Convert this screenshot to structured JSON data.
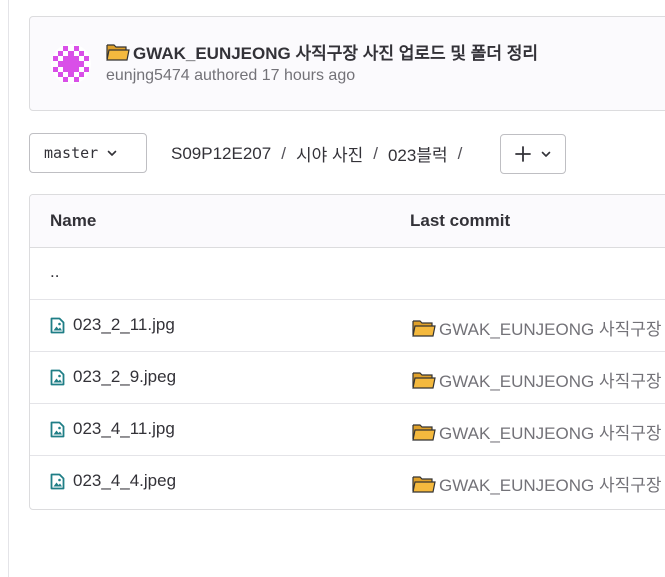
{
  "commit": {
    "emoji_icon": "open-folder-icon",
    "title": "GWAK_EUNJEONG 사직구장 사진 업로드 및 폴더 정리",
    "author": "eunjng5474",
    "authored_label": "authored",
    "time_ago": "17 hours ago"
  },
  "toolbar": {
    "branch": "master",
    "breadcrumb": [
      "S09P12E207",
      "시야 사진",
      "023블럭"
    ],
    "separator": "/",
    "add_icon": "plus-icon"
  },
  "table": {
    "headers": {
      "name": "Name",
      "last_commit": "Last commit"
    },
    "parent_dir": "..",
    "files": [
      {
        "name": "023_2_11.jpg",
        "commit": "GWAK_EUNJEONG 사직구장"
      },
      {
        "name": "023_2_9.jpeg",
        "commit": "GWAK_EUNJEONG 사직구장"
      },
      {
        "name": "023_4_11.jpg",
        "commit": "GWAK_EUNJEONG 사직구장"
      },
      {
        "name": "023_4_4.jpeg",
        "commit": "GWAK_EUNJEONG 사직구장"
      }
    ]
  },
  "colors": {
    "file_icon": "#1f7e86",
    "avatar": "#d94fe8",
    "folder_emoji": "#f4b93e"
  }
}
